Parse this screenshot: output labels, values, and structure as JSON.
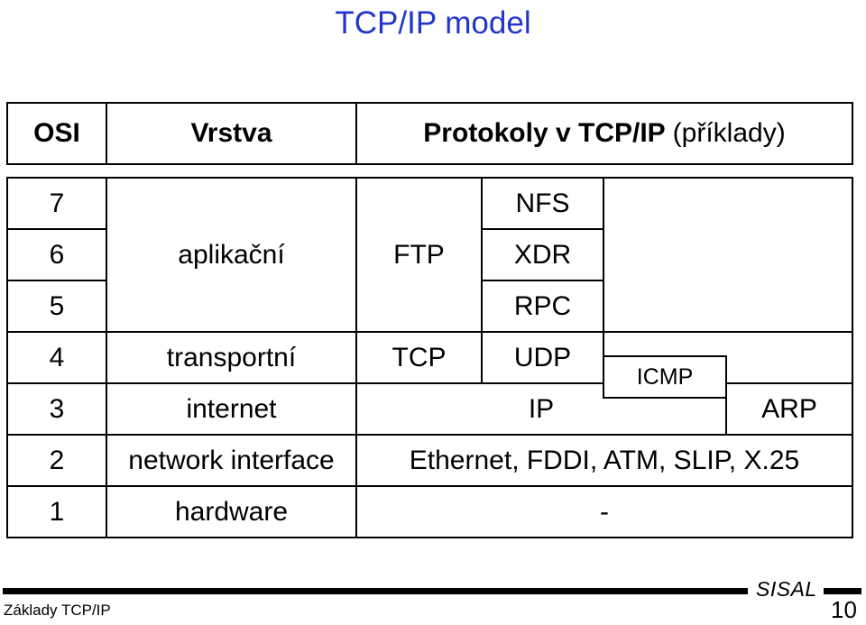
{
  "slide": {
    "title": "TCP/IP model",
    "title_color": "#2236CC"
  },
  "table": {
    "headers": {
      "osi": "OSI",
      "layer": "Vrstva",
      "protocols_bold": "Protokoly v TCP/IP",
      "protocols_plain": "(příklady)"
    },
    "osi_numbers": {
      "n7": "7",
      "n6": "6",
      "n5": "5",
      "n4": "4",
      "n3": "3",
      "n2": "2",
      "n1": "1"
    },
    "layers": {
      "application": "aplikační",
      "transport": "transportní",
      "internet": "internet",
      "network_interface": "network interface",
      "hardware": "hardware"
    },
    "protocols": {
      "ftp": "FTP",
      "nfs": "NFS",
      "xdr": "XDR",
      "rpc": "RPC",
      "tcp": "TCP",
      "udp": "UDP",
      "icmp": "ICMP",
      "ip": "IP",
      "arp": "ARP",
      "link_layer": "Ethernet, FDDI, ATM, SLIP, X.25",
      "hardware_none": "-"
    }
  },
  "footer": {
    "course": "Základy TCP/IP",
    "brand": "SISAL",
    "page_number": "10"
  }
}
